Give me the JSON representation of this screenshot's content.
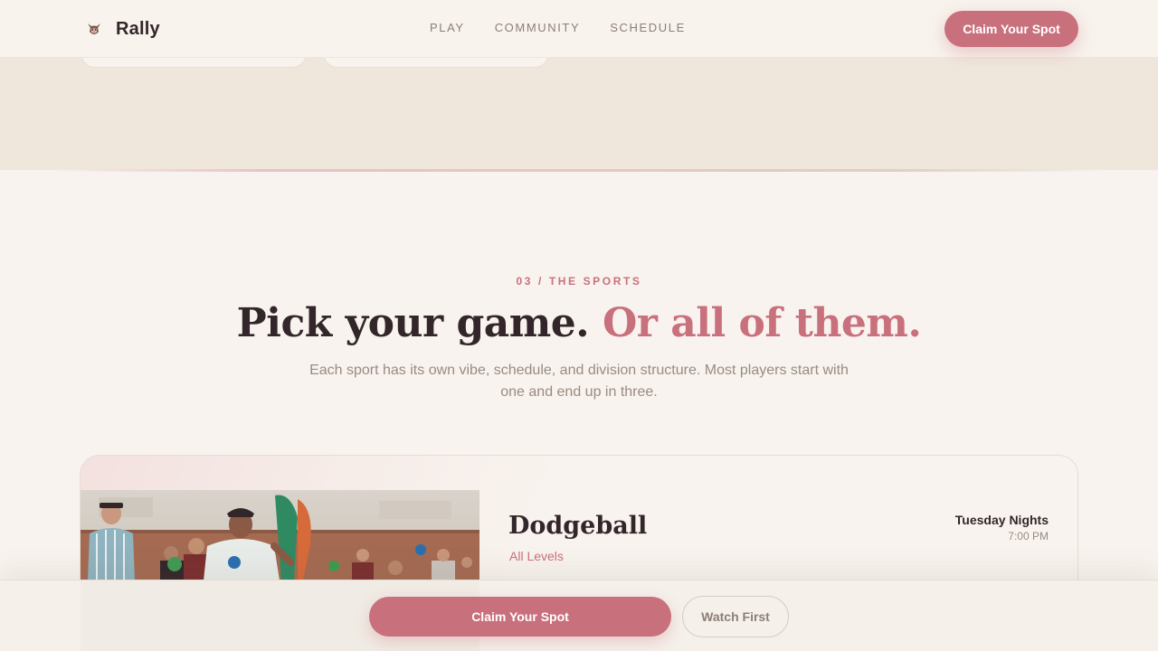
{
  "header": {
    "brand": "Rally",
    "logo_icon": "dog-mascot-icon",
    "nav": [
      "PLAY",
      "COMMUNITY",
      "SCHEDULE"
    ],
    "cta_label": "Claim Your Spot"
  },
  "section": {
    "eyebrow": "03 / THE SPORTS",
    "headline_main": "Pick your game. ",
    "headline_accent": "Or all of them.",
    "subtitle": "Each sport has its own vibe, schedule, and division structure. Most players start with one and end up in three."
  },
  "sport": {
    "name": "Dodgeball",
    "level": "All Levels",
    "day": "Tuesday Nights",
    "time": "7:00 PM"
  },
  "bottom_bar": {
    "primary_label": "Claim Your Spot",
    "secondary_label": "Watch First"
  },
  "colors": {
    "accent": "#c9707d",
    "text_dark": "#33262a",
    "text_muted": "#9a8b82",
    "background": "#f8f3ee",
    "band": "#f0e7dc"
  }
}
